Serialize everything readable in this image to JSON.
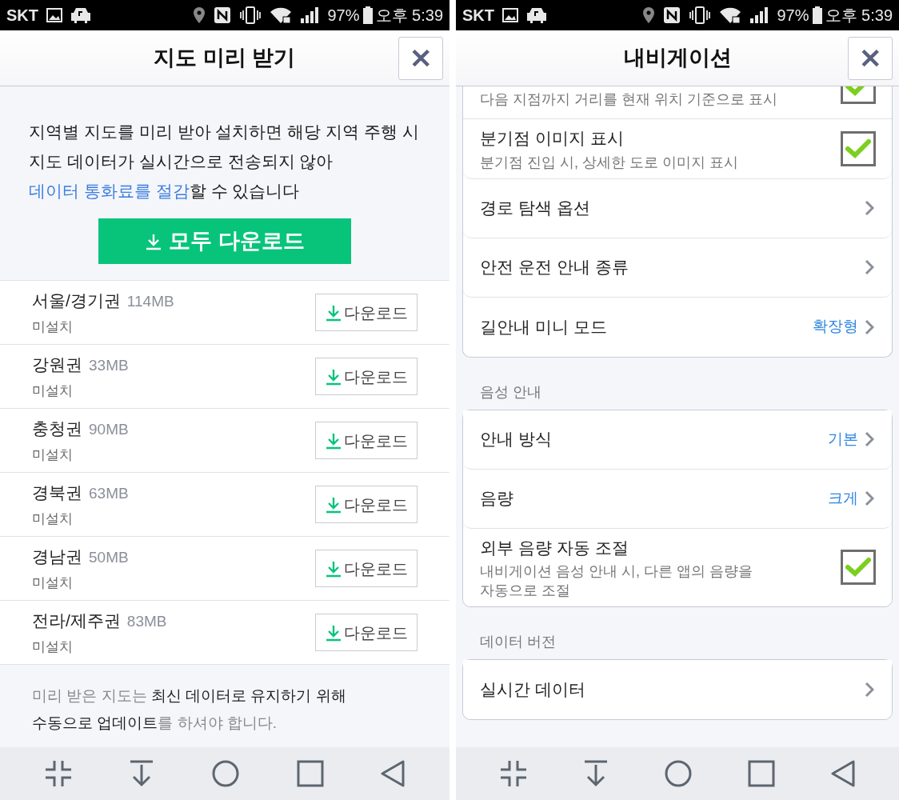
{
  "screens": [
    {
      "kind": "download",
      "status_bar": {
        "carrier": "SKT",
        "battery": "97%",
        "time": "오후 5:39"
      },
      "title": "지도 미리 받기",
      "close": "✕",
      "intro": [
        {
          "kind": "plain",
          "text": "지역별 지도를 미리 받아 설치하면 해당 지역 주행 시 지도 데이터가 실시간으로 전송되지 않아 "
        },
        {
          "kind": "link",
          "text": "데이터 통화료를 절감"
        },
        {
          "kind": "plain",
          "text": "할 수 있습니다"
        }
      ],
      "download_all": "모두 다운로드",
      "regions": [
        {
          "name": "서울/경기권",
          "size": "114MB",
          "status": "미설치",
          "action": "다운로드"
        },
        {
          "name": "강원권",
          "size": "33MB",
          "status": "미설치",
          "action": "다운로드"
        },
        {
          "name": "충청권",
          "size": "90MB",
          "status": "미설치",
          "action": "다운로드"
        },
        {
          "name": "경북권",
          "size": "63MB",
          "status": "미설치",
          "action": "다운로드"
        },
        {
          "name": "경남권",
          "size": "50MB",
          "status": "미설치",
          "action": "다운로드"
        },
        {
          "name": "전라/제주권",
          "size": "83MB",
          "status": "미설치",
          "action": "다운로드"
        }
      ],
      "note": [
        {
          "kind": "muted",
          "text": "미리 받은 지도는 "
        },
        {
          "kind": "strong",
          "text": "최신 데이터로 유지하기 위해 수동으로 업데이트"
        },
        {
          "kind": "muted",
          "text": "를 하셔야 합니다."
        }
      ]
    },
    {
      "kind": "settings",
      "status_bar": {
        "carrier": "SKT",
        "battery": "97%",
        "time": "오후 5:39"
      },
      "title": "내비게이션",
      "close": "✕",
      "groups": [
        {
          "rows": [
            {
              "kind": "check",
              "subtitle": "다음 지점까지 거리를 현재 위치 기준으로 표시",
              "checked": true
            },
            {
              "kind": "check",
              "title": "분기점 이미지 표시",
              "subtitle": "분기점 진입 시, 상세한 도로 이미지 표시",
              "checked": true
            },
            {
              "kind": "link",
              "title": "경로 탐색 옵션"
            },
            {
              "kind": "link",
              "title": "안전 운전 안내 종류"
            },
            {
              "kind": "link",
              "title": "길안내 미니 모드",
              "value": "확장형"
            }
          ]
        },
        {
          "heading": "음성 안내",
          "rows": [
            {
              "kind": "link",
              "title": "안내 방식",
              "value": "기본"
            },
            {
              "kind": "link",
              "title": "음량",
              "value": "크게"
            },
            {
              "kind": "check",
              "title": "외부 음량 자동 조절",
              "subtitle": "내비게이션 음성 안내 시, 다른 앱의 음량을 자동으로 조절",
              "checked": true
            }
          ]
        },
        {
          "heading": "데이터 버전",
          "rows": [
            {
              "kind": "link",
              "title": "실시간 데이터"
            }
          ]
        }
      ]
    }
  ]
}
